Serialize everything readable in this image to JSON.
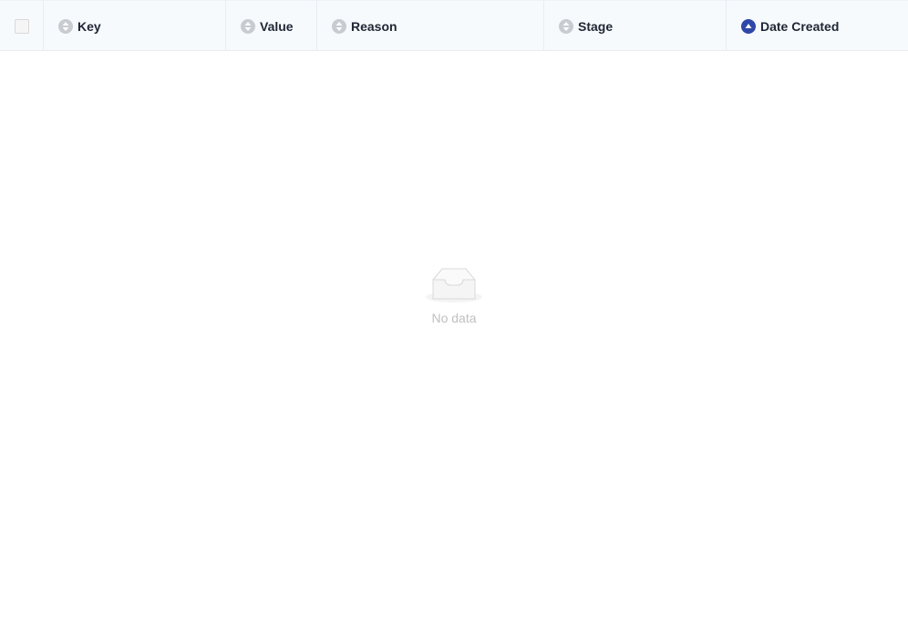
{
  "table": {
    "columns": [
      {
        "id": "key",
        "label": "Key",
        "sort": "none"
      },
      {
        "id": "value",
        "label": "Value",
        "sort": "none"
      },
      {
        "id": "reason",
        "label": "Reason",
        "sort": "none"
      },
      {
        "id": "stage",
        "label": "Stage",
        "sort": "none"
      },
      {
        "id": "date_created",
        "label": "Date Created",
        "sort": "ascending"
      }
    ],
    "select_all_checked": false,
    "empty_text": "No data",
    "colors": {
      "sort_inactive": "#c8cbd0",
      "sort_active": "#2f47a8",
      "header_bg": "#f7fafd"
    }
  }
}
